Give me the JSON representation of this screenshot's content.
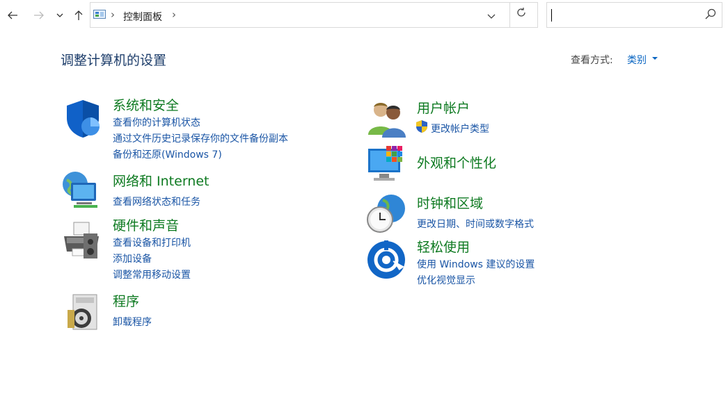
{
  "address": {
    "breadcrumb": "控制面板"
  },
  "search": {
    "placeholder": ""
  },
  "header": {
    "title": "调整计算机的设置",
    "view_by_label": "查看方式:",
    "view_by_value": "类别"
  },
  "categories": {
    "system": {
      "title": "系统和安全",
      "links": [
        "查看你的计算机状态",
        "通过文件历史记录保存你的文件备份副本",
        "备份和还原(Windows 7)"
      ]
    },
    "network": {
      "title": "网络和 Internet",
      "links": [
        "查看网络状态和任务"
      ]
    },
    "hardware": {
      "title": "硬件和声音",
      "links": [
        "查看设备和打印机",
        "添加设备",
        "调整常用移动设置"
      ]
    },
    "programs": {
      "title": "程序",
      "links": [
        "卸载程序"
      ]
    },
    "users": {
      "title": "用户帐户",
      "links": [
        "更改帐户类型"
      ]
    },
    "appearance": {
      "title": "外观和个性化",
      "links": []
    },
    "clock": {
      "title": "时钟和区域",
      "links": [
        "更改日期、时间或数字格式"
      ]
    },
    "ease": {
      "title": "轻松使用",
      "links": [
        "使用 Windows 建议的设置",
        "优化视觉显示"
      ]
    }
  },
  "colors": {
    "category_title": "#0e7a21",
    "link": "#1a55a5",
    "heading": "#1e3e6b"
  }
}
